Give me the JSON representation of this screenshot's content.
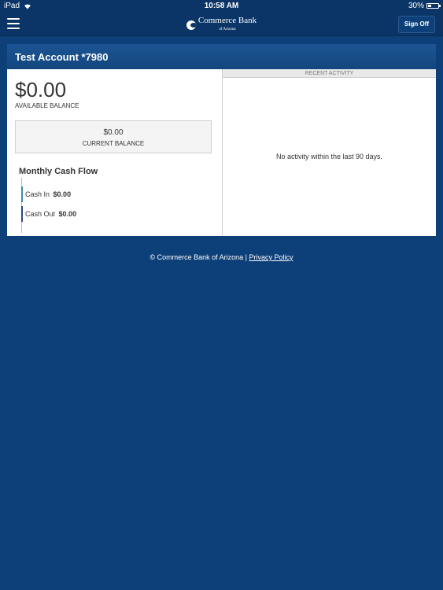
{
  "status_bar": {
    "device": "iPad",
    "time": "10:58 AM",
    "battery_percent": "30%",
    "battery_level": 0.3
  },
  "header": {
    "logo_name": "Commerce Bank",
    "logo_sub": "of Arizona",
    "sign_off_label": "Sign Off",
    "menu_icon": "hamburger-icon"
  },
  "account": {
    "title": "Test Account *7980",
    "available_balance": "$0.00",
    "available_label": "AVAILABLE BALANCE",
    "current_balance": "$0.00",
    "current_label": "CURRENT BALANCE",
    "cash_flow_title": "Monthly Cash Flow",
    "cash_in_label": "Cash In",
    "cash_in_value": "$0.00",
    "cash_out_label": "Cash Out",
    "cash_out_value": "$0.00"
  },
  "recent_activity": {
    "header": "RECENT ACTIVITY",
    "empty_message": "No activity within the last 90 days."
  },
  "footer": {
    "copyright": "© Commerce Bank of Arizona |",
    "privacy_link": "Privacy Policy"
  },
  "colors": {
    "background": "#0d3f78",
    "header": "#0a3566",
    "title_bar": "#1c5594",
    "cash_in_accent": "#3a8aa8",
    "cash_out_accent": "#2a4a78"
  }
}
